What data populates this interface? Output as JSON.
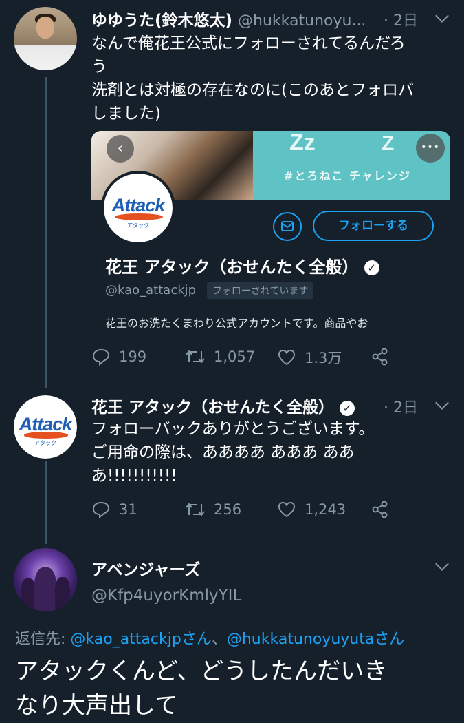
{
  "tweet1": {
    "name": "ゆゆうた(鈴木悠太)",
    "handle": "@hukkatunoyu...",
    "time": "· 2日",
    "text": "なんで俺花王公式にフォローされてるんだろ\nう\n洗剤とは対極の存在なのに(このあとフォロバ\nしました)",
    "card": {
      "zz1": "Zz",
      "zz2": "Z",
      "tag": "#とろねこ チャレンジ",
      "logo_word": "Attack",
      "logo_sub": "アタック",
      "follow_label": "フォローする",
      "name": "花王 アタック（おせんたく全般）",
      "handle": "@kao_attackjp",
      "follows_you": "フォローされています",
      "bio": "花王のお洗たくまわり公式アカウントです。商品やお"
    },
    "replies": "199",
    "retweets": "1,057",
    "likes": "1.3万"
  },
  "tweet2": {
    "logo_word": "Attack",
    "logo_sub": "アタック",
    "name": "花王 アタック（おせんたく全般）",
    "time": "· 2日",
    "text": "フォローバックありがとうございます。\nご用命の際は、ああああ あああ ああ\nあ!!!!!!!!!!!",
    "replies": "31",
    "retweets": "256",
    "likes": "1,243"
  },
  "tweet3": {
    "name": "アベンジャーズ",
    "handle": "@Kfp4uyorKmlyYIL",
    "reply_label": "返信先: ",
    "mention1": "@kao_attackjpさん",
    "separator": "、",
    "mention2": "@hukkatunoyuyutaさん",
    "text": "アタックくんど、どうしたんだいき\nなり大声出して"
  },
  "colors": {
    "background": "#15202b",
    "secondary_text": "#8899a6",
    "accent": "#1da1f2"
  },
  "icons": [
    "reply-icon",
    "retweet-icon",
    "like-icon",
    "share-icon",
    "chevron-down-icon",
    "verified-icon",
    "mail-icon"
  ]
}
